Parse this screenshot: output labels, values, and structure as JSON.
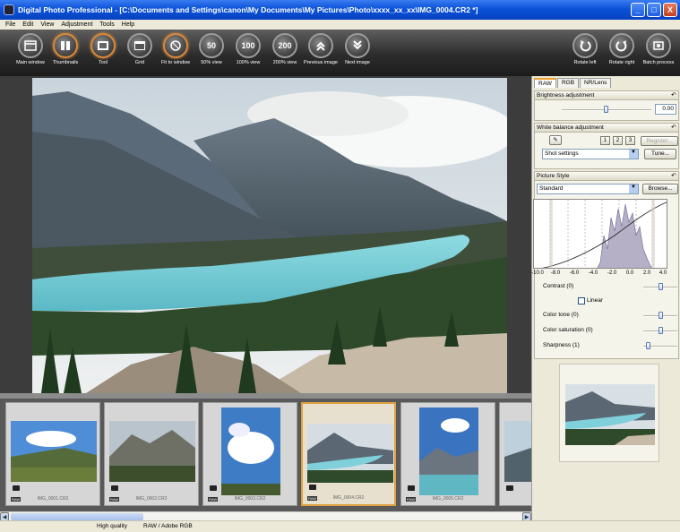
{
  "window": {
    "title": "Digital Photo Professional - [C:\\Documents and Settings\\canon\\My Documents\\My Pictures\\Photo\\xxxx_xx_xx\\IMG_0004.CR2 *]",
    "minimize": "_",
    "maximize": "□",
    "close": "X"
  },
  "menu": [
    "File",
    "Edit",
    "View",
    "Adjustment",
    "Tools",
    "Help"
  ],
  "toolbar": {
    "main_window": "Main window",
    "thumbnails": "Thumbnails",
    "tool": "Tool",
    "grid": "Grid",
    "fit_to_window": "Fit to window",
    "view_50": "50% view",
    "view_100": "100% view",
    "view_200": "200% view",
    "previous_image": "Previous image",
    "next_image": "Next image",
    "rotate_left": "Rotate left",
    "rotate_right": "Rotate right",
    "batch_process": "Batch process",
    "glyph_50": "50",
    "glyph_100": "100",
    "glyph_200": "200"
  },
  "thumbnails": [
    {
      "file": "IMG_0001.CR2",
      "badge": "RAW"
    },
    {
      "file": "IMG_0002.CR2",
      "badge": "RAW"
    },
    {
      "file": "IMG_0003.CR2",
      "badge": "RAW"
    },
    {
      "file": "IMG_0004.CR2",
      "badge": "RAW",
      "selected": true
    },
    {
      "file": "IMG_0005.CR2",
      "badge": "RAW"
    }
  ],
  "status": {
    "quality": "High quality",
    "format": "RAW / Adobe RGB"
  },
  "panel": {
    "tabs": [
      "RAW",
      "RGB",
      "NR/Lens"
    ],
    "active_tab": "RAW",
    "brightness": {
      "title": "Brightness adjustment",
      "value": "0.00",
      "level": 0.5
    },
    "white_balance": {
      "title": "White balance adjustment",
      "presets": [
        "1",
        "2",
        "3"
      ],
      "register": "Register...",
      "select": "Shot settings",
      "tune": "Tune..."
    },
    "picture_style": {
      "title": "Picture Style",
      "select": "Standard",
      "browse": "Browse...",
      "histogram_axis": [
        "-10.0",
        "-8.0",
        "-6.0",
        "-4.0",
        "-2.0",
        "0.0",
        "2.0",
        "4.0"
      ],
      "contrast": "Contrast (0)",
      "linear": "Linear",
      "color_tone": "Color tone (0)",
      "color_saturation": "Color saturation (0)",
      "sharpness": "Sharpness (1)"
    }
  },
  "colors": {
    "accent": "#f0a030",
    "titlebar": "#0a52d8",
    "toolbar": "#2c2c2c",
    "lake": "#6fc9d4"
  }
}
